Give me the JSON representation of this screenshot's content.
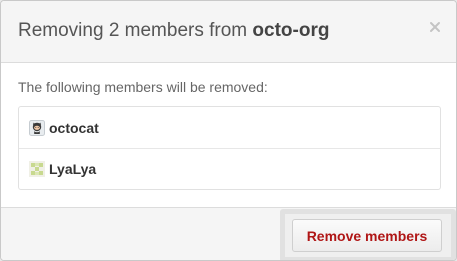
{
  "dialog": {
    "title_prefix": "Removing 2 members from ",
    "org_name": "octo-org",
    "close_icon": "close-icon",
    "intro": "The following members will be removed:",
    "members": [
      {
        "username": "octocat",
        "avatar_icon": "octocat-avatar-icon"
      },
      {
        "username": "LyaLya",
        "avatar_icon": "identicon-avatar-icon"
      }
    ],
    "remove_button_label": "Remove members"
  },
  "colors": {
    "danger_text": "#b01616",
    "header_bg": "#f5f5f5",
    "border": "#dcdcdc"
  }
}
